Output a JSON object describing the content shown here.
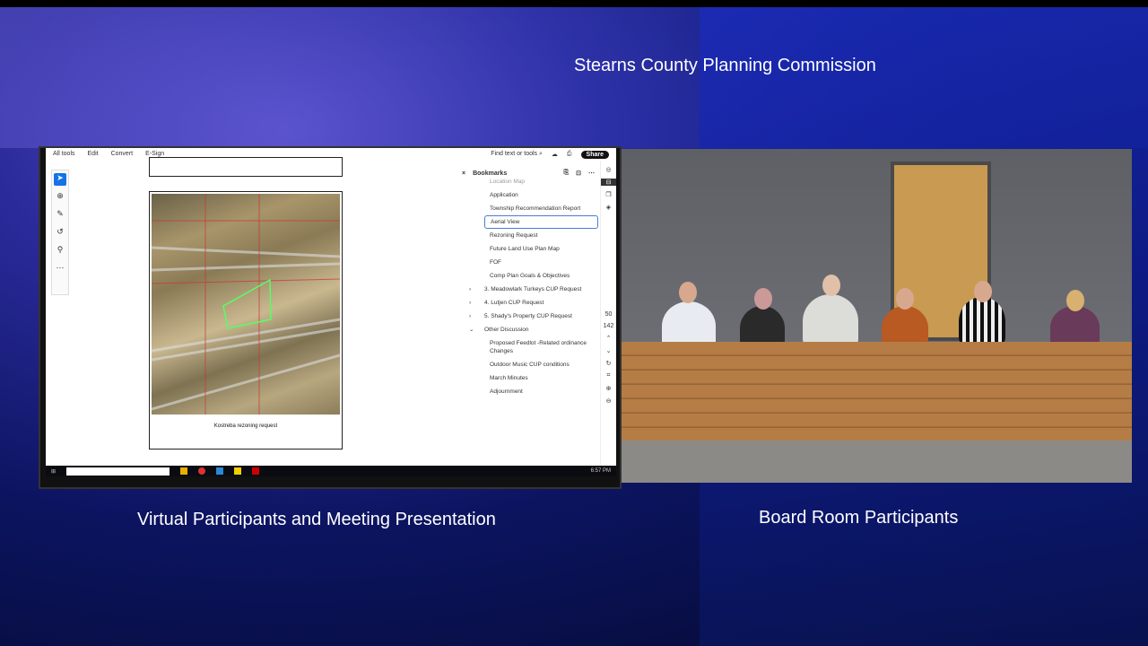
{
  "header": {
    "title": "Stearns County Planning Commission"
  },
  "captions": {
    "left": "Virtual Participants and Meeting Presentation",
    "right": "Board Room Participants"
  },
  "acrobat": {
    "menu": [
      "All tools",
      "Edit",
      "Convert",
      "E-Sign"
    ],
    "search_placeholder": "Find text or tools",
    "share_label": "Share",
    "page_caption": "Kostreba rezoning request",
    "bookmarks": {
      "title": "Bookmarks",
      "items": [
        {
          "label": "Location Map",
          "level": 2
        },
        {
          "label": "Application",
          "level": 2
        },
        {
          "label": "Township Recommendation Report",
          "level": 2
        },
        {
          "label": "Aerial View",
          "level": 2,
          "selected": true
        },
        {
          "label": "Rezoning Request",
          "level": 2
        },
        {
          "label": "Future Land Use Plan Map",
          "level": 2
        },
        {
          "label": "FOF",
          "level": 2
        },
        {
          "label": "Comp Plan Goals & Objectives",
          "level": 2
        },
        {
          "label": "3. Meadowlark Turkeys CUP Request",
          "level": 1,
          "chev": "›"
        },
        {
          "label": "4. Lutjen CUP Request",
          "level": 1,
          "chev": "›"
        },
        {
          "label": "5. Shady's Property CUP Request",
          "level": 1,
          "chev": "›"
        },
        {
          "label": "Other Discussion",
          "level": 1,
          "chev": "⌄"
        },
        {
          "label": "Proposed Feedlot -Related ordinance Changes",
          "level": 2
        },
        {
          "label": "Outdoor Music CUP conditions",
          "level": 2
        },
        {
          "label": "March Minutes",
          "level": 2
        },
        {
          "label": "Adjournment",
          "level": 2
        }
      ]
    },
    "page_number": "50",
    "page_total": "142",
    "clock": "6:57 PM"
  }
}
